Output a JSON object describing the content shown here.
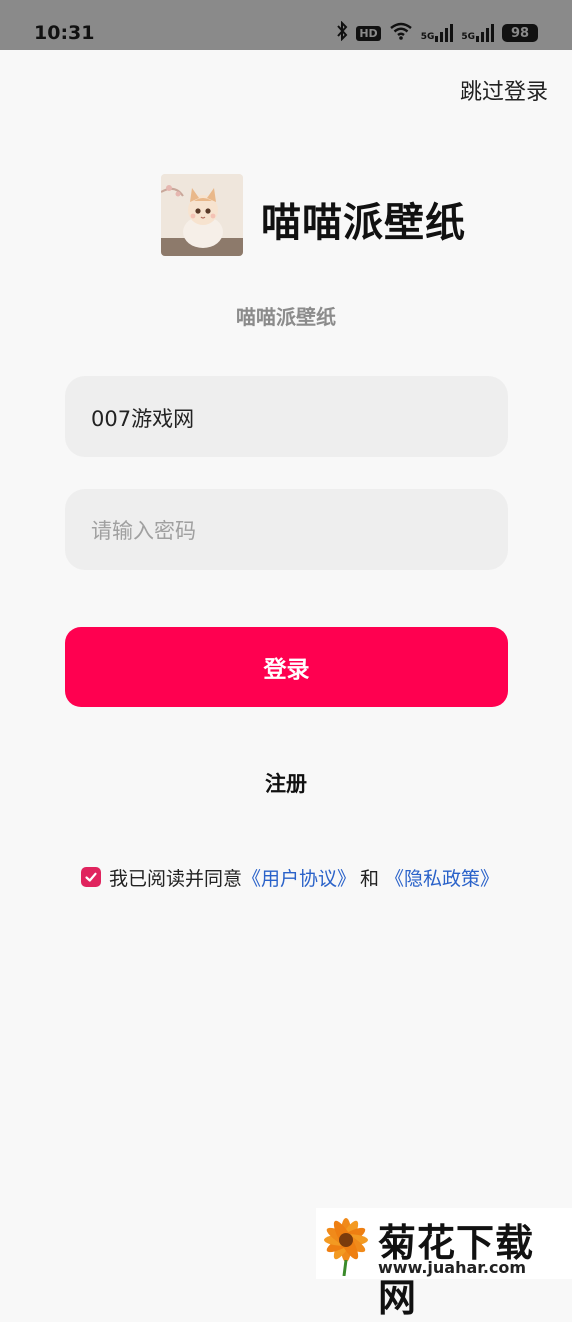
{
  "status_bar": {
    "time": "10:31",
    "hd_badge": "HD",
    "signal_1": "5G",
    "signal_2": "5G",
    "battery": "98"
  },
  "header": {
    "skip_login": "跳过登录"
  },
  "brand": {
    "title": "喵喵派壁纸",
    "subtitle": "喵喵派壁纸",
    "logo_icon": "cat-avatar-icon"
  },
  "form": {
    "username_value": "007游戏网",
    "password_placeholder": "请输入密码",
    "login_label": "登录",
    "register_label": "注册"
  },
  "agreement": {
    "checked": true,
    "prefix": "我已阅读并同意",
    "user_agreement": "《用户协议》",
    "and": "和",
    "privacy_policy": "《隐私政策》"
  },
  "watermark": {
    "title": "菊花下载网",
    "url": "www.juahar.com"
  },
  "colors": {
    "primary": "#ff0050",
    "link": "#2a62c9",
    "checkbox": "#e0245e",
    "status_bar": "#8a8a8a",
    "background": "#f8f8f8"
  }
}
